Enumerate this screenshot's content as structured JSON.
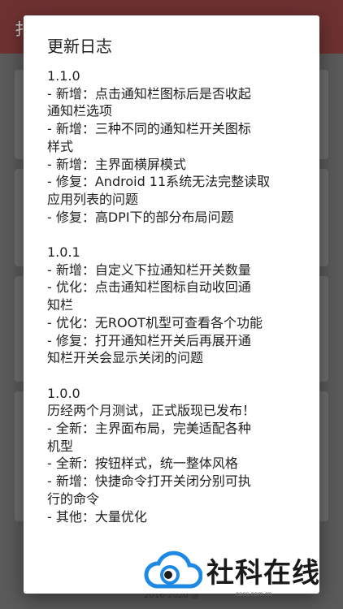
{
  "background": {
    "appbar_title": "扌",
    "footer": "2016-2020 @"
  },
  "dialog": {
    "title": "更新日志",
    "releases": [
      {
        "version": "1.1.0",
        "lines": [
          "- 新增：点击通知栏图标后是否收起",
          "通知栏选项",
          "- 新增：三种不同的通知栏开关图标",
          "样式",
          "- 新增：主界面横屏模式",
          "- 修复：Android 11系统无法完整读取",
          "应用列表的问题",
          "- 修复：高DPI下的部分布局问题"
        ]
      },
      {
        "version": "1.0.1",
        "lines": [
          "- 新增：自定义下拉通知栏开关数量",
          "- 优化：点击通知栏图标自动收回通",
          "知栏",
          "- 优化：无ROOT机型可查看各个功能",
          "- 修复：打开通知栏开关后再展开通",
          "知栏开关会显示关闭的问题"
        ]
      },
      {
        "version": "1.0.0",
        "lines": [
          "历经两个月测试，正式版现已发布！",
          "- 全新：主界面布局，完美适配各种",
          "机型",
          "- 全新：按钮样式，统一整体风格",
          "- 新增：快捷命令打开关闭分别可执",
          "行的命令",
          "- 其他：大量优化"
        ]
      }
    ]
  },
  "watermark": {
    "text": "社科在线",
    "url": "cass.com.cn"
  },
  "colors": {
    "appbar_dimmed": "#6e3131",
    "scrim": "#5a5a5a",
    "dialog_bg": "#ffffff",
    "text": "#212121",
    "logo_blue": "#1e88e5"
  }
}
